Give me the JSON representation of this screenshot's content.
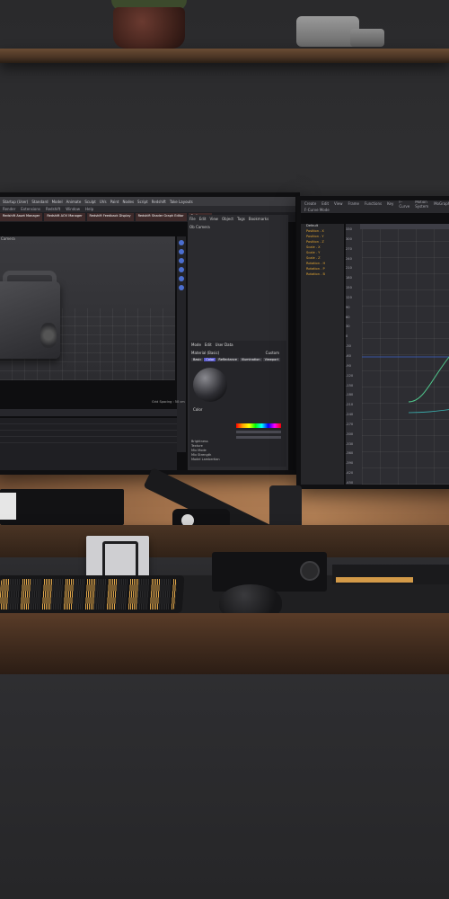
{
  "scene": {
    "description_free": true,
    "left_monitor": {
      "topbar_labels": [
        "Startup (User)",
        "Standard",
        "Model",
        "Animate",
        "Sculpt",
        "UVs",
        "Paint",
        "Nodes",
        "Script",
        "Redshift",
        "Take Layouts"
      ],
      "menu_labels": [
        "Render",
        "Extensions",
        "Redshift",
        "Window",
        "Help"
      ],
      "tabs": [
        "Redshift Asset Manager",
        "Redshift AOV Manager",
        "Redshift Feedback Display",
        "Redshift Shader Graph Editor",
        "Preferences"
      ],
      "viewport_label": "Camera",
      "panel_menu": [
        "File",
        "Edit",
        "View",
        "Object",
        "Tags",
        "Bookmarks"
      ],
      "panel_camera": "Ob Camera",
      "material": {
        "header_menu": [
          "Mode",
          "Edit",
          "User Data"
        ],
        "name": "Material (Basic)",
        "mode": "Custom",
        "tabs": [
          "Basic",
          "Color",
          "Reflectance",
          "Illumination",
          "Viewport"
        ],
        "active_tab": "Color",
        "section": "Color",
        "fields": [
          "Brightness",
          "Texture",
          "Mix Mode",
          "Mix Strength",
          "Model"
        ],
        "model_value": "Lambertian"
      },
      "timeline_label": "Grid Spacing : 50 cm"
    },
    "right_monitor": {
      "menu_labels": [
        "Create",
        "Edit",
        "View",
        "Frame",
        "Functions",
        "Key",
        "F-Curve",
        "Motion System",
        "MoGraph",
        "Bookmarks"
      ],
      "panel_label": "F-Curve Mode",
      "tracks": [
        {
          "label": "Default",
          "color": "white"
        },
        {
          "label": "Position . X",
          "color": "orange"
        },
        {
          "label": "Position . Y",
          "color": "orange"
        },
        {
          "label": "Position . Z",
          "color": "orange"
        },
        {
          "label": "Scale . X",
          "color": "orange"
        },
        {
          "label": "Scale . Y",
          "color": "orange"
        },
        {
          "label": "Scale . Z",
          "color": "orange"
        },
        {
          "label": "Rotation . H",
          "color": "orange"
        },
        {
          "label": "Rotation . P",
          "color": "orange"
        },
        {
          "label": "Rotation . B",
          "color": "orange"
        }
      ],
      "y_axis_ticks": [
        "330",
        "300",
        "270",
        "240",
        "210",
        "180",
        "150",
        "120",
        "90",
        "60",
        "30",
        "0",
        "-30",
        "-60",
        "-90",
        "-120",
        "-150",
        "-180",
        "-210",
        "-240",
        "-270",
        "-300",
        "-330",
        "-360",
        "-390",
        "-420",
        "-450"
      ]
    },
    "colors": {
      "accent_blue": "#4b6ecf",
      "key_orange": "#e0a64a",
      "wood": "#5a3c28",
      "wall_glow": "#b07e54"
    }
  }
}
